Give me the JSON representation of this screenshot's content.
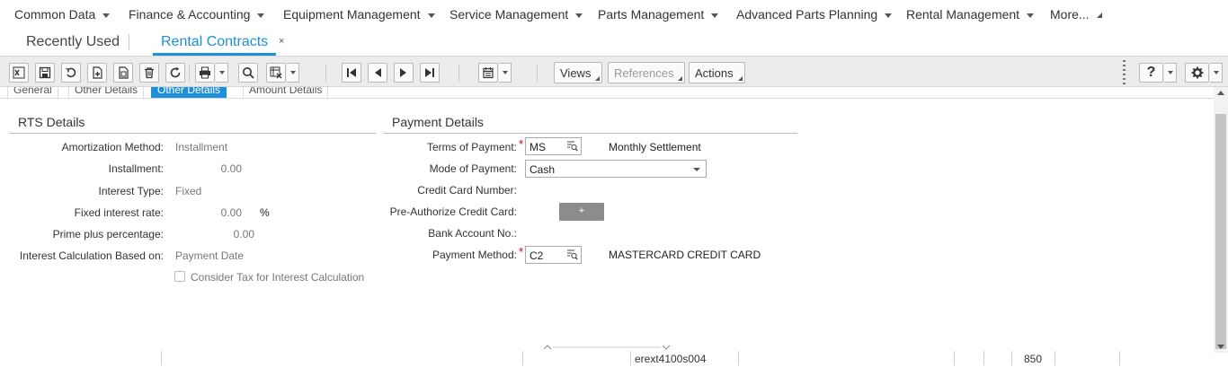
{
  "topnav": {
    "items": [
      "Common Data",
      "Finance & Accounting",
      "Equipment Management",
      "Service Management",
      "Parts Management",
      "Advanced Parts Planning",
      "Rental Management"
    ],
    "more": "More..."
  },
  "tabs": {
    "recent": "Recently Used",
    "active": "Rental Contracts",
    "close": "×"
  },
  "toolbar": {
    "views": "Views",
    "references": "References",
    "actions": "Actions",
    "help": "?"
  },
  "subtabs": [
    "General",
    "Other Details",
    "Other Details",
    "Amount Details"
  ],
  "rts": {
    "title": "RTS Details",
    "amortization_label": "Amortization Method:",
    "amortization_value": "Installment",
    "installment_label": "Installment:",
    "installment_value": "0.00",
    "interest_type_label": "Interest Type:",
    "interest_type_value": "Fixed",
    "fixed_rate_label": "Fixed interest rate:",
    "fixed_rate_value": "0.00",
    "fixed_rate_unit": "%",
    "prime_label": "Prime plus percentage:",
    "prime_value": "0.00",
    "calc_based_label": "Interest Calculation Based on:",
    "calc_based_value": "Payment Date",
    "consider_tax_label": "Consider Tax for Interest Calculation"
  },
  "payment": {
    "title": "Payment Details",
    "terms_label": "Terms of Payment:",
    "terms_value": "MS",
    "terms_desc": "Monthly Settlement",
    "mode_label": "Mode of Payment:",
    "mode_value": "Cash",
    "cc_number_label": "Credit Card Number:",
    "preauth_label": "Pre-Authorize Credit Card:",
    "preauth_button": "+",
    "bank_label": "Bank Account No.:",
    "method_label": "Payment Method:",
    "method_value": "C2",
    "method_desc": "MASTERCARD CREDIT CARD",
    "required_mark": "*"
  },
  "status": {
    "session": "erext4100s004",
    "company": "850"
  }
}
